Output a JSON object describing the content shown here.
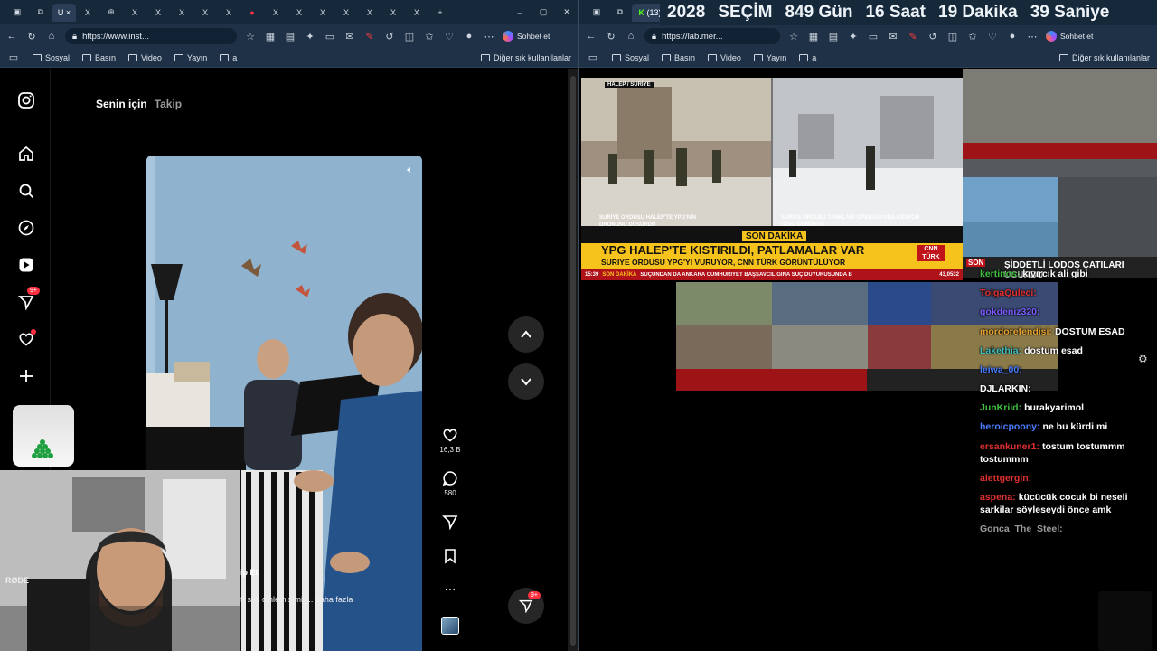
{
  "left_browser": {
    "tabs": [
      "U",
      "X",
      "X",
      "X",
      "X",
      "X",
      "X",
      "X",
      "X",
      "X",
      "X",
      "X",
      "X",
      "X",
      "X",
      "X"
    ],
    "url": "https://www.inst...",
    "copilot_label": "Sohbet et",
    "bookmarks": [
      "Sosyal",
      "Basın",
      "Video",
      "Yayın",
      "a"
    ],
    "bookmarks_other": "Diğer sık kullanılanlar"
  },
  "right_browser": {
    "tab_count_label": "(13)",
    "url": "https://lab.mer...",
    "copilot_label": "Sohbet et",
    "bookmarks": [
      "Sosyal",
      "Basın",
      "Video",
      "Yayın",
      "a"
    ],
    "bookmarks_other": "Diğer sık kullanılanlar"
  },
  "countdown": {
    "year": "2028",
    "label": "SEÇİM",
    "days": "849 Gün",
    "hours": "16 Saat",
    "minutes": "19 Dakika",
    "seconds": "39 Saniye"
  },
  "instagram": {
    "tab_for_you": "Senin için",
    "tab_following": "Takip",
    "nav_badge": "9+",
    "like_count": "16,3 B",
    "comment_count": "580",
    "caption_follow": "ip Et",
    "caption_text": "ft ses dinlemiş miy... daha fazla",
    "share_badge": "9+",
    "webcam_brand": "RØDE"
  },
  "news": {
    "top_label": "HALEP / SURİYE",
    "left_caption": "SURİYE ORDUSU HALEP'TE YPG'NİN DRONUNU DÜŞÜRDÜ",
    "right_caption": "SURİYE ORDUSU TANKLARI OPERASYONA GİDİYOR-ÖZEL GÖRÜNTÜ",
    "son_dakika": "SON DAKİKA",
    "headline": "YPG HALEP'TE KISTIRILDI, PATLAMALAR VAR",
    "subheadline": "SURİYE ORDUSU YPG'Yİ VURUYOR, CNN TÜRK GÖRÜNTÜLÜYOR",
    "ticker_time": "15:39",
    "ticker_label": "SON DAKİKA",
    "ticker_text": "SUÇUNDAN DA ANKARA CUMHURİYET BAŞSAVCILIĞINA SUÇ DUYURUSUNDA B",
    "ticker_index": "43,0532",
    "channel": "CNN TÜRK",
    "side_headline": "ŞİDDETLİ LODOS ÇATILARI UÇURDU",
    "side_label": "SON"
  },
  "chat": [
    {
      "user": "kertinos:",
      "text": "kıvırcık ali gibi",
      "color": "#3fbf3f"
    },
    {
      "user": "ToigaQuleci:",
      "text": "",
      "color": "#e03030"
    },
    {
      "user": "gokdeniz320:",
      "text": "",
      "color": "#7a5cff"
    },
    {
      "user": "mordorefendisi:",
      "text": "DOSTUM ESAD",
      "color": "#e2a030"
    },
    {
      "user": "Lakethia:",
      "text": "dostum esad",
      "color": "#3fbfbf"
    },
    {
      "user": "leiwa_00:",
      "text": "",
      "color": "#4a7cff"
    },
    {
      "user": "DJLARKIN:",
      "text": "",
      "color": "#ffffff"
    },
    {
      "user": "JunKriid:",
      "text": "burakyarimol",
      "color": "#3fbf3f"
    },
    {
      "user": "heroicpoony:",
      "text": "ne bu kürdi mi",
      "color": "#4a7cff"
    },
    {
      "user": "ersankuner1:",
      "text": "tostum tostummm tostummm",
      "color": "#e03030"
    },
    {
      "user": "alettgergin:",
      "text": "",
      "color": "#e03030"
    },
    {
      "user": "aspena:",
      "text": "kücücük cocuk bi neseli sarkilar söyleseydi önce amk",
      "color": "#e03030"
    },
    {
      "user": "Gonca_The_Steel:",
      "text": "",
      "color": "#9a9a9a"
    }
  ]
}
